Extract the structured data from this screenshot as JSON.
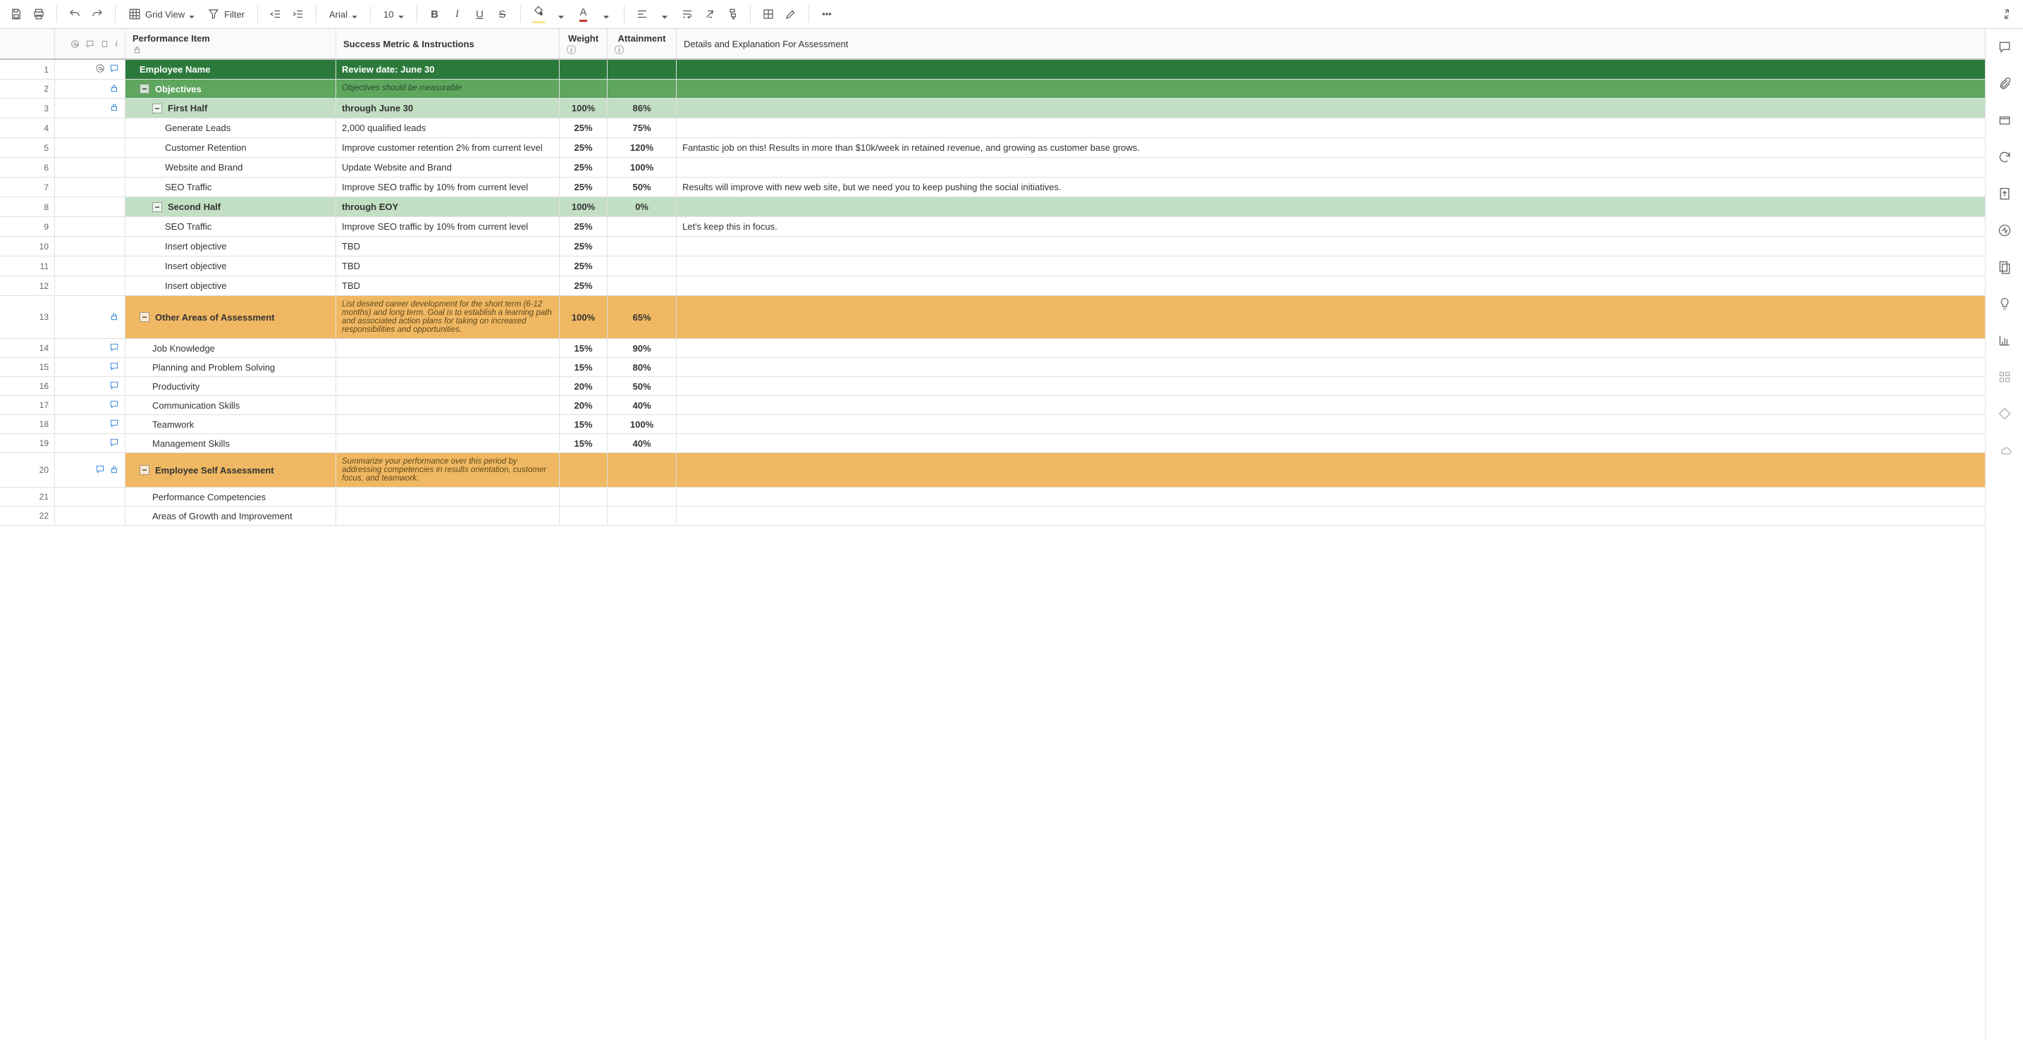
{
  "toolbar": {
    "view_label": "Grid View",
    "filter_label": "Filter",
    "font_name": "Arial",
    "font_size": "10"
  },
  "columns": {
    "item": "Performance Item",
    "metric": "Success Metric & Instructions",
    "weight": "Weight",
    "attainment": "Attainment",
    "details": "Details and Explanation For Assessment"
  },
  "rows": [
    {
      "n": 1,
      "cls": "bg-dark-green",
      "indent": 1,
      "collapse": "",
      "item": "Employee Name",
      "metric": "Review date: June 30",
      "weight": "",
      "attain": "",
      "details": "",
      "icons": [
        "at",
        "comment"
      ]
    },
    {
      "n": 2,
      "cls": "bg-med-green",
      "indent": 1,
      "collapse": "-",
      "item": "Objectives",
      "metric_note": "Objectives should be measurable",
      "weight": "",
      "attain": "",
      "details": "",
      "icons": [
        "lock"
      ]
    },
    {
      "n": 3,
      "cls": "bg-lt-green",
      "indent": 2,
      "collapse": "-",
      "item": "First Half",
      "metric": "through June 30",
      "weight": "100%",
      "attain": "86%",
      "details": "",
      "icons": [
        "lock"
      ]
    },
    {
      "n": 4,
      "cls": "",
      "indent": 3,
      "item": "Generate Leads",
      "metric": "2,000 qualified leads",
      "weight": "25%",
      "attain": "75%",
      "details": ""
    },
    {
      "n": 5,
      "cls": "",
      "indent": 3,
      "item": "Customer Retention",
      "metric": "Improve customer retention 2% from current level",
      "weight": "25%",
      "attain": "120%",
      "details": "Fantastic job on this! Results in more than $10k/week in retained revenue, and growing as customer base grows."
    },
    {
      "n": 6,
      "cls": "",
      "indent": 3,
      "item": "Website and Brand",
      "metric": "Update Website and Brand",
      "weight": "25%",
      "attain": "100%",
      "details": ""
    },
    {
      "n": 7,
      "cls": "",
      "indent": 3,
      "item": "SEO Traffic",
      "metric": "Improve SEO traffic by 10% from current level",
      "weight": "25%",
      "attain": "50%",
      "details": "Results will improve with new web site, but we need you to keep pushing the social initiatives."
    },
    {
      "n": 8,
      "cls": "bg-lt-green",
      "indent": 2,
      "collapse": "-",
      "item": "Second Half",
      "metric": "through EOY",
      "weight": "100%",
      "attain": "0%",
      "details": ""
    },
    {
      "n": 9,
      "cls": "",
      "indent": 3,
      "item": "SEO Traffic",
      "metric": "Improve SEO traffic by 10% from current level",
      "weight": "25%",
      "attain": "",
      "details": "Let's keep this in focus."
    },
    {
      "n": 10,
      "cls": "",
      "indent": 3,
      "item": "Insert objective",
      "metric": "TBD",
      "weight": "25%",
      "attain": "",
      "details": ""
    },
    {
      "n": 11,
      "cls": "",
      "indent": 3,
      "item": "Insert objective",
      "metric": "TBD",
      "weight": "25%",
      "attain": "",
      "details": ""
    },
    {
      "n": 12,
      "cls": "",
      "indent": 3,
      "item": "Insert objective",
      "metric": "TBD",
      "weight": "25%",
      "attain": "",
      "details": ""
    },
    {
      "n": 13,
      "cls": "bg-orange",
      "indent": 1,
      "collapse": "-",
      "item": "Other Areas of Assessment",
      "metric_note": "List desired career development for the short term (6-12 months) and long term. Goal is to establish a learning path and associated action plans for taking on increased responsibilities and opportunities.",
      "weight": "100%",
      "attain": "65%",
      "details": "",
      "icons": [
        "lock"
      ]
    },
    {
      "n": 14,
      "cls": "",
      "indent": 2,
      "item": "Job Knowledge",
      "metric": "",
      "weight": "15%",
      "attain": "90%",
      "details": "",
      "icons": [
        "comment"
      ]
    },
    {
      "n": 15,
      "cls": "",
      "indent": 2,
      "item": "Planning and Problem Solving",
      "metric": "",
      "weight": "15%",
      "attain": "80%",
      "details": "",
      "icons": [
        "comment"
      ]
    },
    {
      "n": 16,
      "cls": "",
      "indent": 2,
      "item": "Productivity",
      "metric": "",
      "weight": "20%",
      "attain": "50%",
      "details": "",
      "icons": [
        "comment"
      ]
    },
    {
      "n": 17,
      "cls": "",
      "indent": 2,
      "item": "Communication Skills",
      "metric": "",
      "weight": "20%",
      "attain": "40%",
      "details": "",
      "icons": [
        "comment"
      ]
    },
    {
      "n": 18,
      "cls": "",
      "indent": 2,
      "item": "Teamwork",
      "metric": "",
      "weight": "15%",
      "attain": "100%",
      "details": "",
      "icons": [
        "comment"
      ]
    },
    {
      "n": 19,
      "cls": "",
      "indent": 2,
      "item": "Management Skills",
      "metric": "",
      "weight": "15%",
      "attain": "40%",
      "details": "",
      "icons": [
        "comment"
      ]
    },
    {
      "n": 20,
      "cls": "bg-orange",
      "indent": 1,
      "collapse": "-",
      "item": "Employee Self Assessment",
      "metric_note": "Summarize your performance over this period by addressing competencies in results orientation, customer focus, and teamwork.",
      "weight": "",
      "attain": "",
      "details": "",
      "icons": [
        "comment",
        "lock"
      ]
    },
    {
      "n": 21,
      "cls": "",
      "indent": 2,
      "item": "Performance Competencies",
      "metric": "",
      "weight": "",
      "attain": "",
      "details": ""
    },
    {
      "n": 22,
      "cls": "",
      "indent": 2,
      "item": "Areas of Growth and Improvement",
      "metric": "",
      "weight": "",
      "attain": "",
      "details": ""
    }
  ]
}
